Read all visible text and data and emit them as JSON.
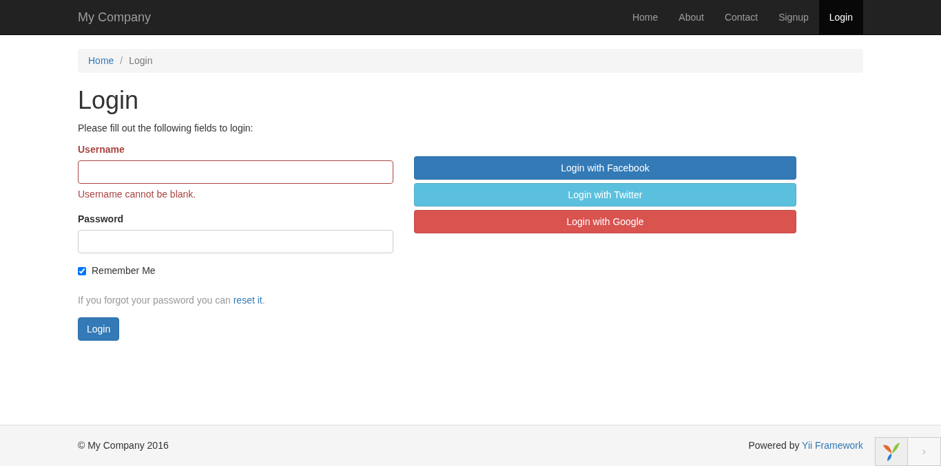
{
  "navbar": {
    "brand": "My Company",
    "items": [
      {
        "label": "Home",
        "selected": false
      },
      {
        "label": "About",
        "selected": false
      },
      {
        "label": "Contact",
        "selected": false
      },
      {
        "label": "Signup",
        "selected": false
      },
      {
        "label": "Login",
        "selected": true
      }
    ]
  },
  "breadcrumb": {
    "items": [
      "Home",
      "Login"
    ],
    "separator": "/"
  },
  "title": "Login",
  "intro": "Please fill out the following fields to login:",
  "fields": [
    {
      "label": "Username",
      "error": "Username cannot be blank.",
      "has_error": true
    },
    {
      "label": "Password",
      "has_error": false
    }
  ],
  "remember": {
    "label": "Remember Me",
    "checked": true
  },
  "reset_text": "If you forgot your password you can ",
  "reset_link": "reset it",
  "reset_end": ".",
  "submit": "Login",
  "social": [
    {
      "label": "Login with Facebook",
      "color": "#337ab7"
    },
    {
      "label": "Login with Twitter",
      "color": "#5bc0de"
    },
    {
      "label": "Login with Google",
      "color": "#d9534f"
    }
  ],
  "footer": {
    "copyright": "© My Company 2016",
    "powered": "Powered by ",
    "powered_link": "Yii Framework",
    "debug_arrow": "›"
  }
}
